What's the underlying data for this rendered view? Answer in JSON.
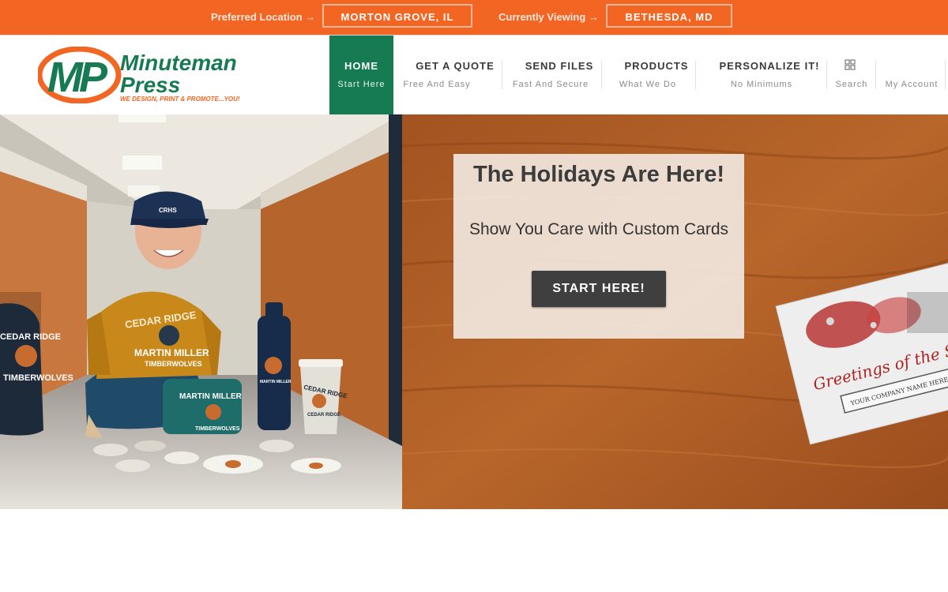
{
  "topbar": {
    "preferred_label": "Preferred Location →",
    "preferred_location": "MORTON GROVE, IL",
    "viewing_label": "Currently Viewing →",
    "viewing_location": "BETHESDA, MD",
    "background_color": "#f26522"
  },
  "logo": {
    "name_line1": "Minuteman",
    "name_line2": "Press",
    "tagline": "WE DESIGN, PRINT & PROMOTE...YOU!"
  },
  "nav": {
    "items": [
      {
        "label": "HOME",
        "sub": "Start Here"
      },
      {
        "label": "GET A QUOTE",
        "sub": "Free And Easy"
      },
      {
        "label": "SEND FILES",
        "sub": "Fast And Secure"
      },
      {
        "label": "PRODUCTS",
        "sub": "What We Do"
      },
      {
        "label": "PERSONALIZE IT!",
        "sub": "No Minimums"
      }
    ],
    "search_label": "Search",
    "account_label": "My Account",
    "active_color": "#167a52"
  },
  "hero": {
    "title": "The Holidays Are Here!",
    "subtitle": "Show You Care with Custom Cards",
    "cta_label": "START HERE!",
    "left_image": {
      "cap_text": "CRHS",
      "hoodie_line1": "CEDAR RIDGE",
      "hoodie_line2": "MARTIN MILLER",
      "hoodie_line3": "TIMBERWOLVES",
      "backpack_line1": "CEDAR RIDGE",
      "backpack_line2": "TIMBERWOLVES",
      "case_line1": "MARTIN MILLER",
      "case_line2": "TIMBERWOLVES",
      "bottle_text": "MARTIN MILLER",
      "cup_line1": "CEDAR RIDGE",
      "cup_line2": "CEDAR RIDGE"
    },
    "card_image": {
      "greeting": "Greetings of the Se",
      "company_placeholder": "YOUR COMPANY NAME HERE"
    }
  }
}
